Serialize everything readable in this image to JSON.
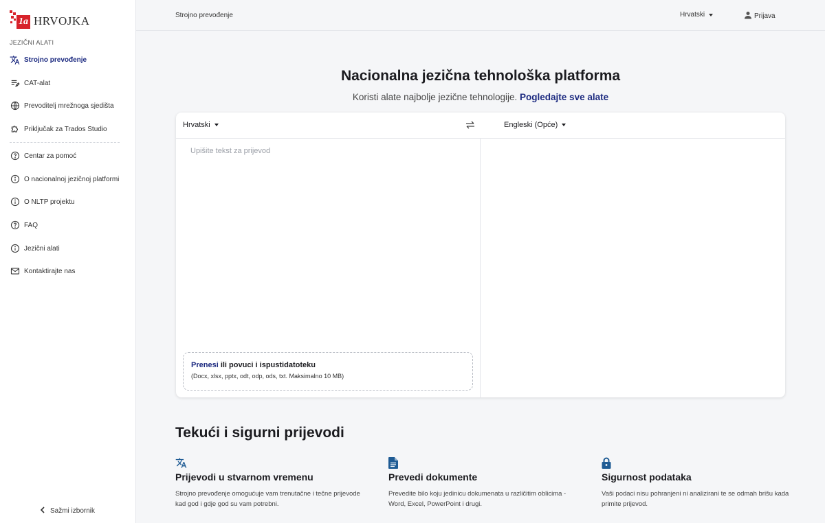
{
  "brand": {
    "name": "HRVOJKA",
    "mark": "1a",
    "color": "#d7222a"
  },
  "sidebar": {
    "section_label": "JEZIČNI ALATI",
    "tools": [
      {
        "label": "Strojno prevođenje",
        "icon": "translate-icon",
        "active": true
      },
      {
        "label": "CAT-alat",
        "icon": "list-edit-icon"
      },
      {
        "label": "Prevoditelj mrežnoga sjedišta",
        "icon": "globe-icon"
      },
      {
        "label": "Priključak za Trados Studio",
        "icon": "puzzle-icon"
      }
    ],
    "info": [
      {
        "label": "Centar za pomoć",
        "icon": "help-circle-icon"
      },
      {
        "label": "O nacionalnoj jezičnoj platformi",
        "icon": "info-circle-icon"
      },
      {
        "label": "O NLTP projektu",
        "icon": "info-circle-icon"
      },
      {
        "label": "FAQ",
        "icon": "help-circle-icon"
      },
      {
        "label": "Jezični alati",
        "icon": "info-circle-icon"
      },
      {
        "label": "Kontaktirajte nas",
        "icon": "mail-icon"
      }
    ],
    "collapse_label": "Sažmi izbornik"
  },
  "topbar": {
    "breadcrumb": "Strojno prevođenje",
    "language": "Hrvatski",
    "login": "Prijava"
  },
  "hero": {
    "title": "Nacionalna jezična tehnološka platforma",
    "subtitle": "Koristi alate najbolje jezične tehnologije.",
    "link": "Pogledajte sve alate"
  },
  "translator": {
    "source_language": "Hrvatski",
    "target_language": "Engleski (Opće)",
    "placeholder": "Upišite tekst za prijevod",
    "upload_link": "Prenesi",
    "upload_text": "ili povuci i ispustidatoteku",
    "upload_hint": "(Docx, xlsx, pptx, odt, odp, ods, txt. Maksimalno 10 MB)"
  },
  "features": {
    "title": "Tekući i sigurni prijevodi",
    "items": [
      {
        "icon": "translate-icon",
        "title": "Prijevodi u stvarnom vremenu",
        "text": "Strojno prevođenje omogućuje vam trenutačne i tečne prijevode kad god i gdje god su vam potrebni."
      },
      {
        "icon": "document-icon",
        "title": "Prevedi dokumente",
        "text": "Prevedite bilo koju jedinicu dokumenata u različitim oblicima - Word, Excel, PowerPoint i drugi."
      },
      {
        "icon": "lock-icon",
        "title": "Sigurnost podataka",
        "text": "Vaši podaci nisu pohranjeni ni analizirani te se odmah brišu kada primite prijevod."
      }
    ]
  },
  "colors": {
    "accent": "#1c2a80",
    "feature_icon": "#1e5b94",
    "background": "#f5f6f8"
  }
}
